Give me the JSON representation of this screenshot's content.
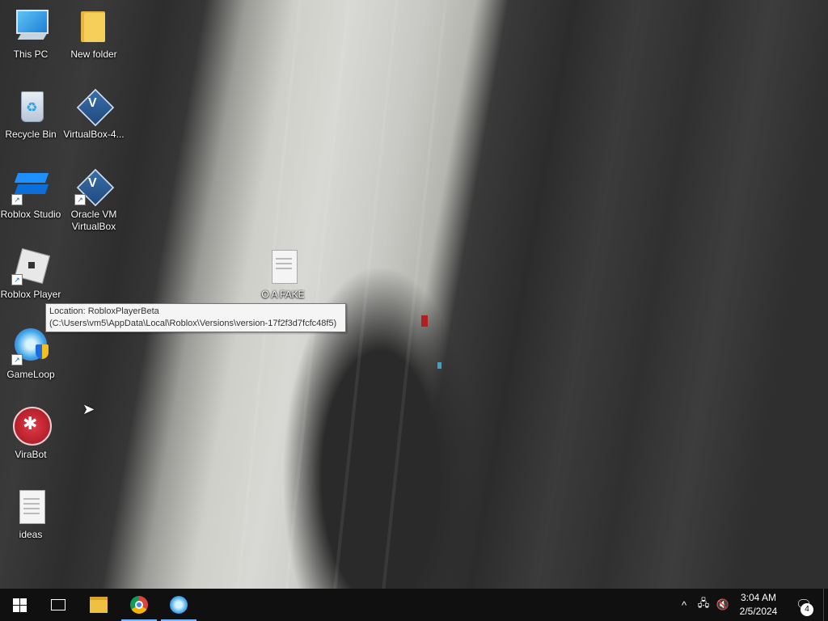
{
  "desktop": {
    "icons": [
      {
        "label": "This PC"
      },
      {
        "label": "New folder"
      },
      {
        "label": "Recycle Bin"
      },
      {
        "label": "VirtualBox-4..."
      },
      {
        "label": "Roblox Studio"
      },
      {
        "label": "Oracle VM VirtualBox"
      },
      {
        "label": "Roblox Player"
      },
      {
        "label": "O A FAKE"
      },
      {
        "label": "GameLoop"
      },
      {
        "label": "ViraBot"
      },
      {
        "label": "ideas"
      }
    ],
    "tooltip": "Location: RobloxPlayerBeta (C:\\Users\\vm5\\AppData\\Local\\Roblox\\Versions\\version-17f2f3d7fcfc48f5)"
  },
  "taskbar": {
    "buttons": [
      {
        "name": "start",
        "icon": "windows-logo-icon"
      },
      {
        "name": "task-view",
        "icon": "task-view-icon"
      },
      {
        "name": "file-explorer",
        "icon": "folder-icon"
      },
      {
        "name": "chrome",
        "icon": "chrome-icon"
      },
      {
        "name": "gameloop",
        "icon": "gameloop-icon"
      }
    ],
    "tray": {
      "chevron": "^",
      "time": "3:04 AM",
      "date": "2/5/2024",
      "notification_count": "4"
    },
    "accent_color": "#78b6ff"
  }
}
